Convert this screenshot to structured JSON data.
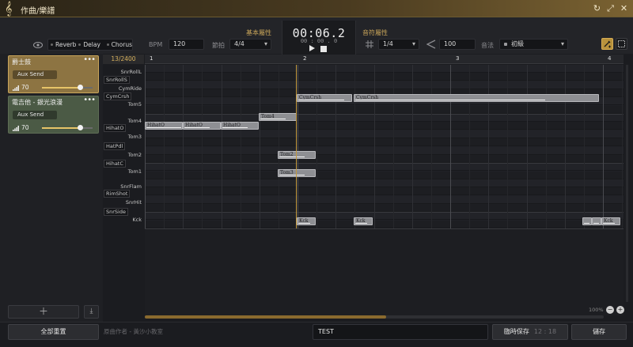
{
  "window": {
    "title": "作曲/樂譜"
  },
  "fx": {
    "reverb": "Reverb",
    "delay": "Delay",
    "chorus": "Chorus"
  },
  "bpm": {
    "label": "BPM",
    "value": "120"
  },
  "meter": {
    "label": "節拍",
    "value": "4/4"
  },
  "section_basic": "基本屬性",
  "section_note": "音符屬性",
  "time": {
    "main": "00:06.2",
    "sub": "00 : 00 . 0"
  },
  "grid_value": "1/4",
  "velocity_value": "100",
  "pitch": {
    "label": "音法",
    "value": "初級"
  },
  "position": "13/2400",
  "ruler_marks": [
    "1",
    "2",
    "3",
    "4"
  ],
  "tracks": [
    {
      "name": "爵士鼓",
      "aux": "Aux Send",
      "volume": "70",
      "level": 0.75,
      "color": "#8d7442"
    },
    {
      "name": "電吉他 - 銀光浪漫",
      "aux": "Aux Send",
      "volume": "70",
      "level": 0.75,
      "color": "#4b5a45"
    }
  ],
  "instruments": [
    "SnrRollL",
    "SnrRollS",
    "CymRide",
    "CymCrsh",
    "Tom5",
    "Tom4",
    "HihatO",
    "Tom3",
    "HatPdl",
    "Tom2",
    "HihatC",
    "Tom1",
    "SnrFlam",
    "RimShot",
    "SnrHit",
    "SnrSide",
    "Kck"
  ],
  "notes": {
    "cymcrsh1": "CymCrsh",
    "cymcrsh2": "CymCrsh",
    "tom4": "Tom4",
    "hihat1": "HihatO",
    "hihat2": "HihatO",
    "hihat3": "HihatO",
    "tom2": "Tom2",
    "tom3": "Tom3",
    "kck1": "Kck",
    "kck2": "Kck",
    "kck3": "Kck"
  },
  "zoom": "100%",
  "footer": {
    "reset": "全部重置",
    "composer": "原曲作者 - 黃沙小教室",
    "song_title": "TEST",
    "temp_save": "臨時保存",
    "temp_save_time": "12 : 18",
    "save": "儲存"
  }
}
